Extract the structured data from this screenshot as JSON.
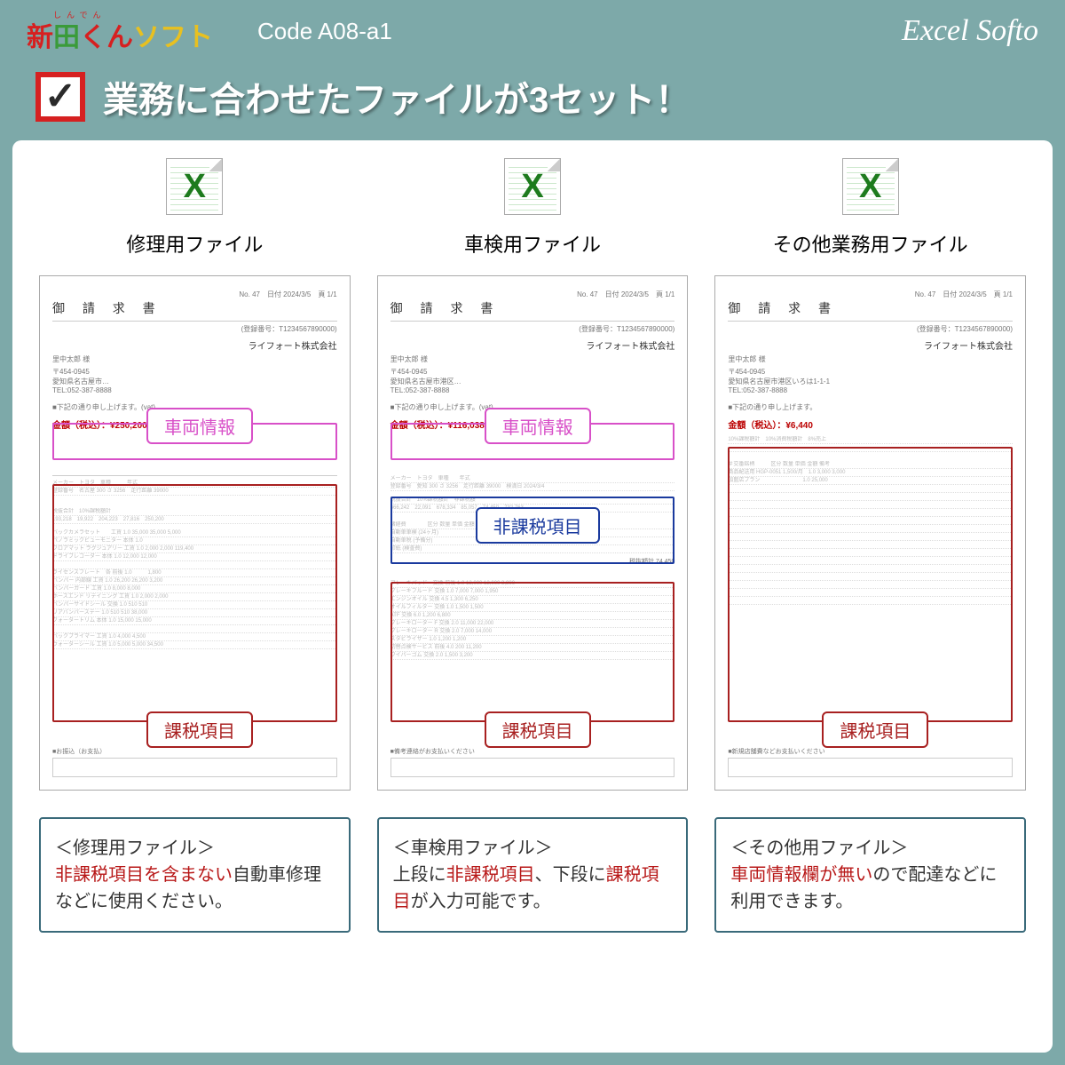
{
  "header": {
    "logo_ruby": "しんでん",
    "logo_red": "新",
    "logo_green": "田",
    "logo_suffix1": "くん",
    "logo_suffix2": "ソフト",
    "code": "Code  A08-a1",
    "brand": "Excel Softo"
  },
  "title": {
    "text": "業務に合わせたファイルが3セット！"
  },
  "columns": [
    {
      "label": "修理用ファイル",
      "doc_title": "御 請 求 書",
      "customer": "里中太郎 様",
      "company": "ライフォート株式会社",
      "amount": "¥250,200",
      "tags": {
        "vehicle": "車両情報",
        "taxed": "課税項目"
      },
      "desc_title": "＜修理用ファイル＞",
      "desc_parts": [
        {
          "t": "非課税項目を含まない",
          "hl": true
        },
        {
          "t": "自動車修理などに使用ください。",
          "hl": false
        }
      ]
    },
    {
      "label": "車検用ファイル",
      "doc_title": "御 請 求 書",
      "customer": "里中太郎 様",
      "company": "ライフォート株式会社",
      "amount": "¥116,038",
      "tags": {
        "vehicle": "車両情報",
        "nontax": "非課税項目",
        "taxed": "課税項目"
      },
      "desc_title": "＜車検用ファイル＞",
      "desc_parts": [
        {
          "t": "上段に",
          "hl": false
        },
        {
          "t": "非課税項目",
          "hl": true
        },
        {
          "t": "、下段に",
          "hl": false
        },
        {
          "t": "課税項目",
          "hl": true
        },
        {
          "t": "が入力可能です。",
          "hl": false
        }
      ]
    },
    {
      "label": "その他業務用ファイル",
      "doc_title": "御 請 求 書",
      "customer": "里中太郎 様",
      "company": "ライフォート株式会社",
      "amount": "¥6,440",
      "tags": {
        "taxed": "課税項目"
      },
      "desc_title": "＜その他用ファイル＞",
      "desc_parts": [
        {
          "t": "車両情報欄が無い",
          "hl": true
        },
        {
          "t": "ので配達などに利用できます。",
          "hl": false
        }
      ]
    }
  ]
}
